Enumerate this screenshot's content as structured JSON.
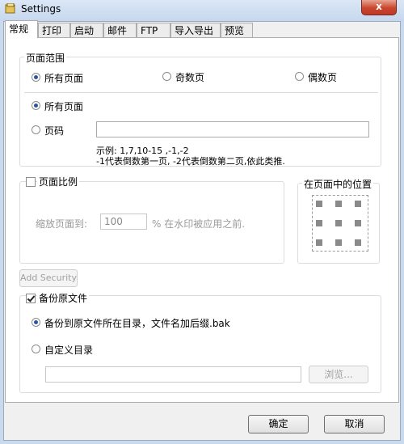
{
  "window": {
    "title": "Settings",
    "close_glyph": "x"
  },
  "tabs": [
    {
      "label": "常规",
      "active": true
    },
    {
      "label": "打印"
    },
    {
      "label": "启动"
    },
    {
      "label": "邮件"
    },
    {
      "label": "FTP"
    },
    {
      "label": "导入导出"
    },
    {
      "label": "预览"
    }
  ],
  "page_range": {
    "legend": "页面范围",
    "all_pages_top": "所有页面",
    "odd_pages": "奇数页",
    "even_pages": "偶数页",
    "all_pages": "所有页面",
    "page_numbers": "页码",
    "page_numbers_value": "",
    "hint_line1": "示例: 1,7,10-15 ,-1,-2",
    "hint_line2": "-1代表倒数第一页, -2代表倒数第二页,依此类推."
  },
  "page_scale": {
    "label": "页面比例",
    "checked": false,
    "scale_label": "缩放页面到:",
    "scale_value": "100",
    "scale_suffix": "% 在水印被应用之前."
  },
  "position": {
    "legend": "在页面中的位置"
  },
  "add_security_button": "Add Security",
  "backup": {
    "label": "备份原文件",
    "checked": true,
    "same_dir": "备份到原文件所在目录，文件名加后缀.bak",
    "custom_dir": "自定义目录",
    "custom_dir_value": "",
    "browse_button": "浏览..."
  },
  "footer": {
    "ok_button": "确定",
    "cancel_button": "取消"
  },
  "icons": {
    "app": "settings-app-icon",
    "close": "close-icon"
  },
  "colors": {
    "close_button": "#c9462c",
    "titlebar": "#c6d7ee",
    "radio_dot": "#2a56a0"
  }
}
